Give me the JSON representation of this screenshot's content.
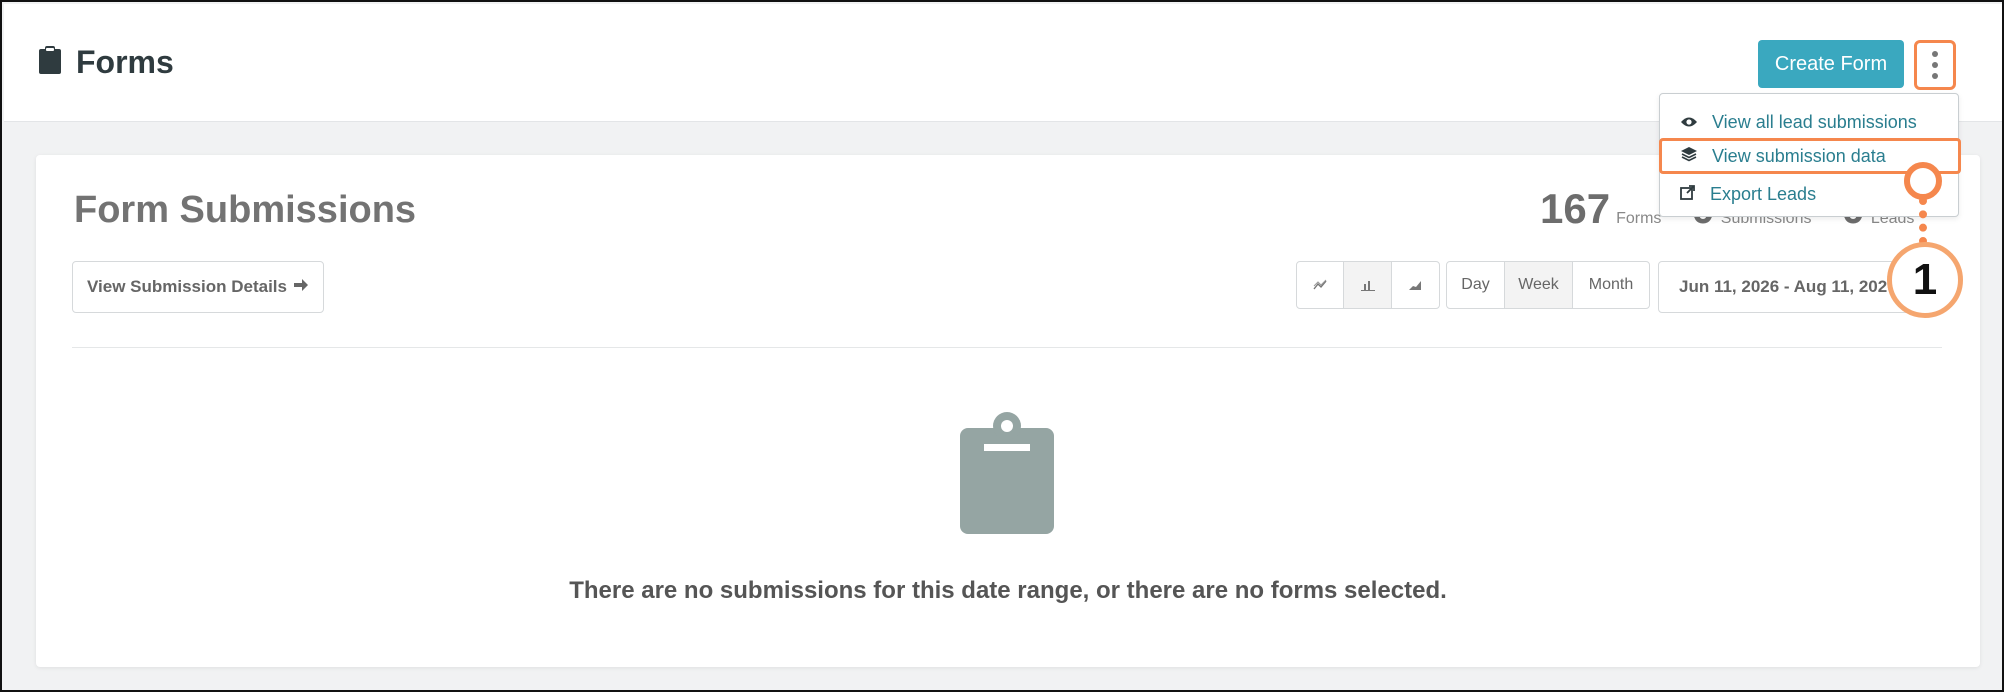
{
  "header": {
    "title": "Forms",
    "create_label": "Create Form",
    "more_label": "More options"
  },
  "menu": {
    "items": [
      {
        "label": "View all lead submissions",
        "icon": "eye-icon"
      },
      {
        "label": "View submission data",
        "icon": "layers-icon"
      },
      {
        "label": "Export Leads",
        "icon": "export-icon"
      }
    ]
  },
  "card": {
    "title": "Form Submissions",
    "stats": [
      {
        "value": "167",
        "label": "Forms"
      },
      {
        "value": "0",
        "label": "Submissions"
      },
      {
        "value": "0",
        "label": "Leads"
      }
    ],
    "details_button": "View Submission Details",
    "chart_types": [
      "line-chart-icon",
      "bar-chart-icon",
      "area-chart-icon"
    ],
    "periods": [
      "Day",
      "Week",
      "Month"
    ],
    "active_period": "Week",
    "date_range": "Jun 11, 2026 - Aug 11, 2026",
    "empty_message": "There are no submissions for this date range, or there are no forms selected."
  },
  "annotation": {
    "number": "1"
  },
  "colors": {
    "accent": "#3aa8bf",
    "link": "#2a7e8f",
    "highlight": "#f5874d",
    "empty_icon": "#95a5a3"
  }
}
